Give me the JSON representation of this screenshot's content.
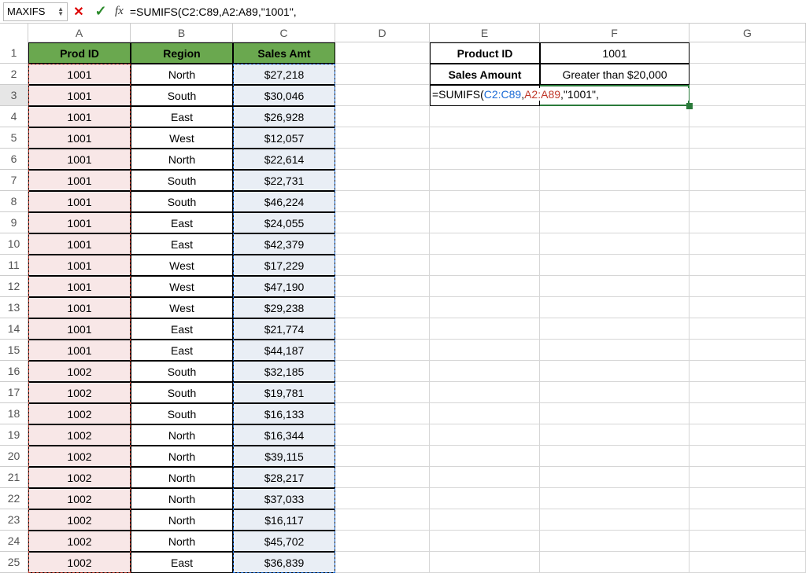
{
  "formula_bar": {
    "name_box": "MAXIFS",
    "cancel": "✕",
    "confirm": "✓",
    "fx": "fx",
    "formula": "=SUMIFS(C2:C89,A2:A89,\"1001\","
  },
  "columns": [
    "A",
    "B",
    "C",
    "D",
    "E",
    "F",
    "G"
  ],
  "row_count": 25,
  "active_row": 3,
  "headers": {
    "A": "Prod ID",
    "B": "Region",
    "C": "Sales Amt"
  },
  "data_rows": [
    {
      "a": "1001",
      "b": "North",
      "c": "$27,218"
    },
    {
      "a": "1001",
      "b": "South",
      "c": "$30,046"
    },
    {
      "a": "1001",
      "b": "East",
      "c": "$26,928"
    },
    {
      "a": "1001",
      "b": "West",
      "c": "$12,057"
    },
    {
      "a": "1001",
      "b": "North",
      "c": "$22,614"
    },
    {
      "a": "1001",
      "b": "South",
      "c": "$22,731"
    },
    {
      "a": "1001",
      "b": "South",
      "c": "$46,224"
    },
    {
      "a": "1001",
      "b": "East",
      "c": "$24,055"
    },
    {
      "a": "1001",
      "b": "East",
      "c": "$42,379"
    },
    {
      "a": "1001",
      "b": "West",
      "c": "$17,229"
    },
    {
      "a": "1001",
      "b": "West",
      "c": "$47,190"
    },
    {
      "a": "1001",
      "b": "West",
      "c": "$29,238"
    },
    {
      "a": "1001",
      "b": "East",
      "c": "$21,774"
    },
    {
      "a": "1001",
      "b": "East",
      "c": "$44,187"
    },
    {
      "a": "1002",
      "b": "South",
      "c": "$32,185"
    },
    {
      "a": "1002",
      "b": "South",
      "c": "$19,781"
    },
    {
      "a": "1002",
      "b": "South",
      "c": "$16,133"
    },
    {
      "a": "1002",
      "b": "North",
      "c": "$16,344"
    },
    {
      "a": "1002",
      "b": "North",
      "c": "$39,115"
    },
    {
      "a": "1002",
      "b": "North",
      "c": "$28,217"
    },
    {
      "a": "1002",
      "b": "North",
      "c": "$37,033"
    },
    {
      "a": "1002",
      "b": "North",
      "c": "$16,117"
    },
    {
      "a": "1002",
      "b": "North",
      "c": "$45,702"
    },
    {
      "a": "1002",
      "b": "East",
      "c": "$36,839"
    }
  ],
  "side_panel": {
    "product_id_label": "Product ID",
    "product_id_value": "1001",
    "sales_amount_label": "Sales Amount",
    "sales_amount_value": "Greater than $20,000",
    "formula_prefix": "=SUMIFS(",
    "ref1": "C2:C89",
    "comma1": ",",
    "ref2": "A2:A89",
    "suffix": ",\"1001\","
  }
}
